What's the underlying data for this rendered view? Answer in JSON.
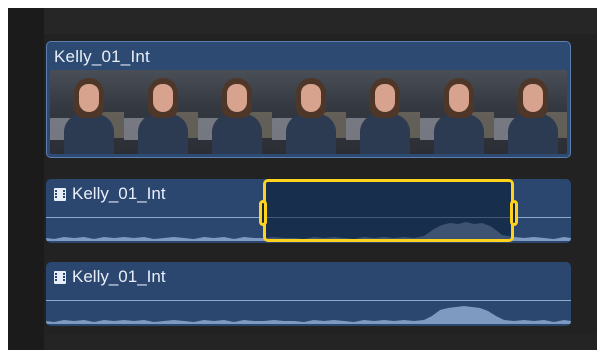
{
  "timeline": {
    "video_clip": {
      "title": "Kelly_01_Int",
      "thumbnail_count": 7
    },
    "audio_clips": [
      {
        "label": "Kelly_01_Int",
        "icon": "film-icon",
        "selected_range": true
      },
      {
        "label": "Kelly_01_Int",
        "icon": "film-icon",
        "selected_range": false
      }
    ],
    "colors": {
      "clip_blue": "#2b4770",
      "selection_yellow": "#ffd21d",
      "background": "#202020"
    }
  }
}
